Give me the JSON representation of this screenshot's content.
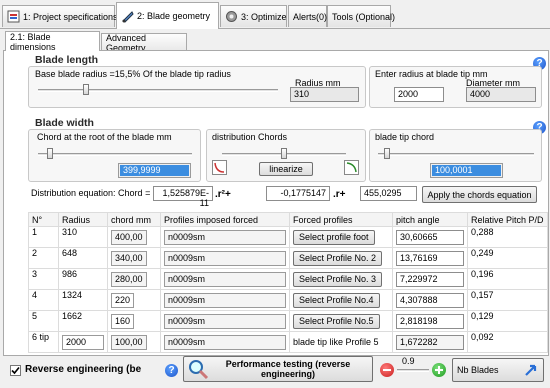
{
  "tabs": [
    {
      "label": "1: Project specifications",
      "icon": "specifications-icon"
    },
    {
      "label": "2: Blade geometry",
      "icon": "blade-geometry-icon"
    },
    {
      "label": "3: Optimize",
      "icon": "optimize-icon"
    },
    {
      "label": "Alerts(0)"
    },
    {
      "label": "Tools (Optional)"
    }
  ],
  "subtabs": [
    "2.1: Blade dimensions",
    "Advanced Geometry"
  ],
  "blade_length": {
    "title": "Blade length",
    "base_radius_label": "Base blade radius =15,5% Of the blade tip radius",
    "base_slider_level": 0.2,
    "radius_label": "Radius mm",
    "radius_value": "310",
    "enter_radius_label": "Enter radius at blade tip mm",
    "diameter_label": "Diameter  mm",
    "tip_radius_value": "2000",
    "diameter_value": "4000"
  },
  "blade_width": {
    "title": "Blade width",
    "root_chord_label": "Chord at the root of the blade mm",
    "root_chord_value": "399,9999",
    "root_slider_level": 0.08,
    "distribution_label": "distribution Chords",
    "distribution_slider_level": 0.5,
    "linearize_label": "linearize",
    "tip_chord_label": "blade tip chord",
    "tip_chord_value": "100,0001",
    "tip_slider_level": 0.06
  },
  "equation": {
    "label": "Distribution equation: Chord =",
    "coef_a": "1,525879E-11",
    "r2_term": ".r²+",
    "coef_b": "-0,1775147",
    "r_term": ".r+",
    "coef_c": "455,0295",
    "apply_label": "Apply the chords equation"
  },
  "table": {
    "headers": [
      "N°",
      "Radius",
      "chord mm",
      "Profiles imposed forced",
      "Forced profiles",
      "pitch angle",
      "Relative Pitch P/D"
    ],
    "rows": [
      {
        "n": "1",
        "radius": "310",
        "chord": "400,00",
        "profile": "n0009sm",
        "button": "Select profile foot",
        "pitch": "30,60665",
        "rel": "0,288"
      },
      {
        "n": "2",
        "radius": "648",
        "chord": "340,00",
        "profile": "n0009sm",
        "button": "Select Profile No. 2",
        "pitch": "13,76169",
        "rel": "0,249"
      },
      {
        "n": "3",
        "radius": "986",
        "chord": "280,00",
        "profile": "n0009sm",
        "button": "Select Profile No. 3",
        "pitch": "7,229972",
        "rel": "0,196"
      },
      {
        "n": "4",
        "radius": "1324",
        "chord": "220",
        "profile": "n0009sm",
        "button": "Select Profile No.4",
        "pitch": "4,307888",
        "rel": "0,157"
      },
      {
        "n": "5",
        "radius": "1662",
        "chord": "160",
        "profile": "n0009sm",
        "button": "Select Profile No.5",
        "pitch": "2,818198",
        "rel": "0,129"
      },
      {
        "n": "6 tip",
        "radius": "2000",
        "chord": "100,00",
        "profile": "n0009sm",
        "button": "blade tip like Profile 5",
        "pitch": "1,672282",
        "rel": "0,092"
      }
    ]
  },
  "bottom": {
    "reverse_label": "Reverse engineering (be",
    "reverse_checked": true,
    "perf_label": "Performance testing (reverse engineering)",
    "stepper_value": "0.9",
    "nb_blades_label": "Nb Blades"
  },
  "colors": {
    "selection": "#3b8de0",
    "help": "#1f55c9"
  }
}
